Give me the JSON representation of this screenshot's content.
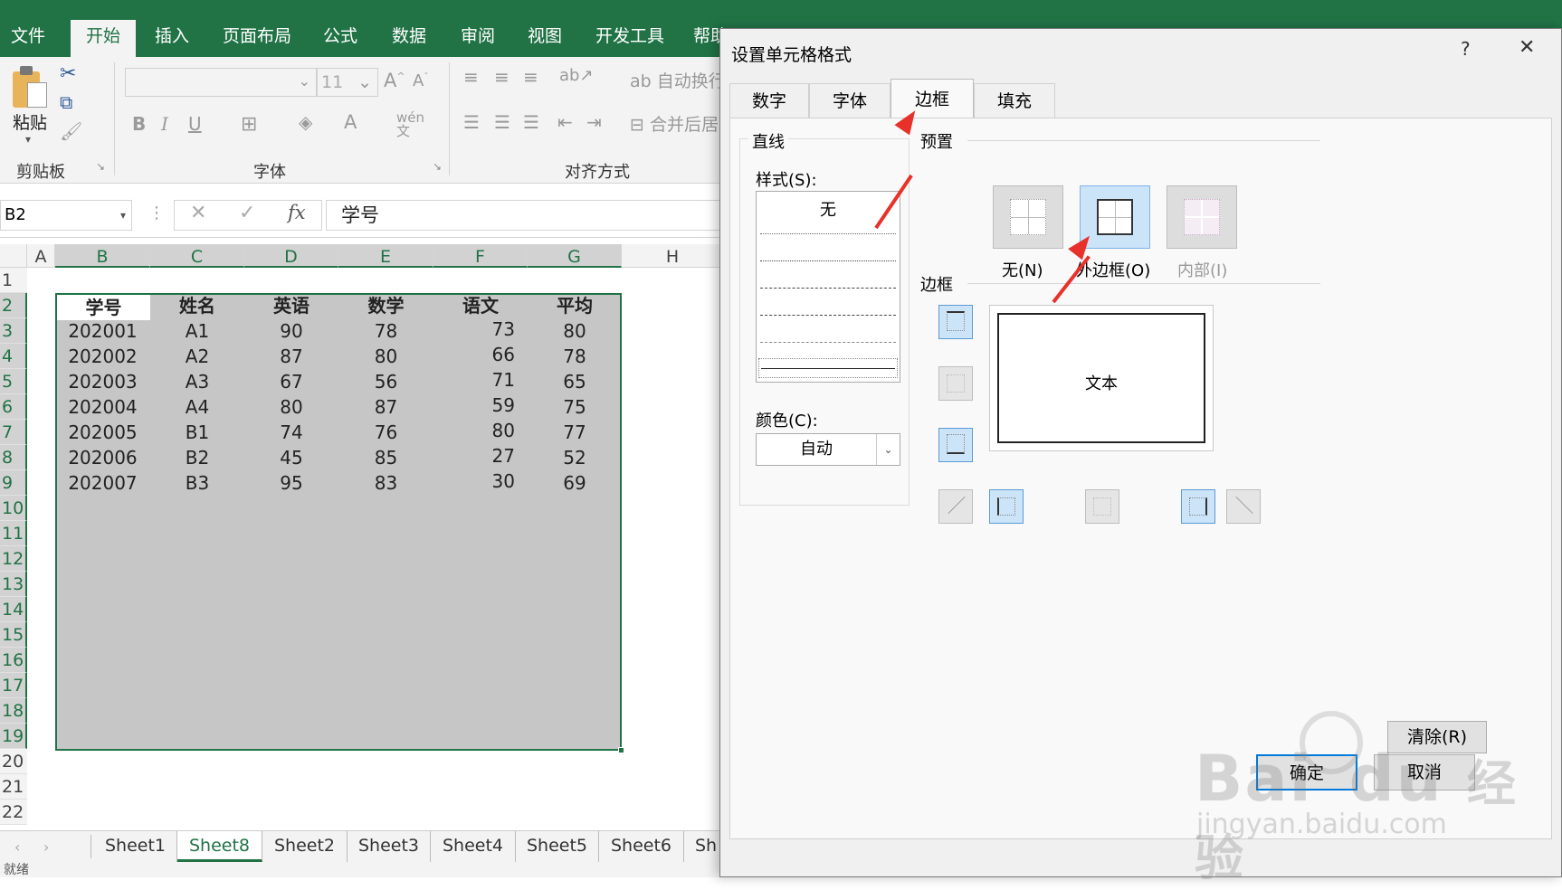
{
  "ribbon": {
    "tabs": [
      "文件",
      "开始",
      "插入",
      "页面布局",
      "公式",
      "数据",
      "审阅",
      "视图",
      "开发工具",
      "帮助"
    ],
    "active_tab": "开始",
    "clipboard": {
      "paste_label": "粘贴",
      "group_label": "剪贴板"
    },
    "font": {
      "size": "11",
      "bold": "B",
      "italic": "I",
      "underline": "U",
      "group_label": "字体"
    },
    "align": {
      "wrap_label": "自动换行",
      "merge_label": "合并后居",
      "group_label": "对齐方式"
    }
  },
  "formula_bar": {
    "name_box": "B2",
    "content": "学号",
    "fx": "fx"
  },
  "sheet": {
    "columns": [
      "A",
      "B",
      "C",
      "D",
      "E",
      "F",
      "G",
      "H"
    ],
    "rows": [
      "1",
      "2",
      "3",
      "4",
      "5",
      "6",
      "7",
      "8",
      "9",
      "10",
      "11",
      "12",
      "13",
      "14",
      "15",
      "16",
      "17",
      "18",
      "19",
      "20",
      "21",
      "22"
    ],
    "headers": [
      "学号",
      "姓名",
      "英语",
      "数学",
      "语文",
      "平均"
    ],
    "data": [
      [
        "202001",
        "A1",
        "90",
        "78",
        "73",
        "80"
      ],
      [
        "202002",
        "A2",
        "87",
        "80",
        "66",
        "78"
      ],
      [
        "202003",
        "A3",
        "67",
        "56",
        "71",
        "65"
      ],
      [
        "202004",
        "A4",
        "80",
        "87",
        "59",
        "75"
      ],
      [
        "202005",
        "B1",
        "74",
        "76",
        "80",
        "77"
      ],
      [
        "202006",
        "B2",
        "45",
        "85",
        "27",
        "52"
      ],
      [
        "202007",
        "B3",
        "95",
        "83",
        "30",
        "69"
      ]
    ]
  },
  "sheet_tabs": [
    "Sheet1",
    "Sheet8",
    "Sheet2",
    "Sheet3",
    "Sheet4",
    "Sheet5",
    "Sheet6",
    "Sh"
  ],
  "active_sheet": "Sheet8",
  "status": "就绪",
  "dialog": {
    "title": "设置单元格格式",
    "help": "?",
    "close": "✕",
    "tabs": [
      "数字",
      "字体",
      "边框",
      "填充"
    ],
    "active_tab": "边框",
    "line_section": "直线",
    "style_label": "样式(S):",
    "style_none": "无",
    "color_label": "颜色(C):",
    "color_value": "自动",
    "preset_section": "预置",
    "presets": [
      "无(N)",
      "外边框(O)",
      "内部(I)"
    ],
    "border_section": "边框",
    "preview_text": "文本",
    "clear_button": "清除(R)",
    "ok_button": "确定",
    "cancel_button": "取消"
  },
  "watermark": {
    "brand": "Bai",
    "brand2": "du",
    "cn": "经验",
    "url": "jingyan.baidu.com"
  }
}
